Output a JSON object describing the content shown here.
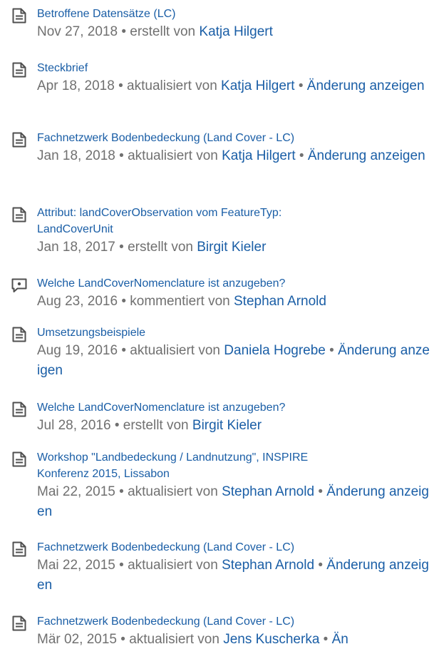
{
  "feed": {
    "items": [
      {
        "icon": "page-icon",
        "title": "Betroffene Datensätze (LC)",
        "date": "Nov 27, 2018",
        "bullet": "•",
        "action": "erstellt von",
        "author": "Katja Hilgert",
        "change_link": ""
      },
      {
        "icon": "page-icon",
        "title": "Steckbrief",
        "date": "Apr 18, 2018",
        "bullet": "•",
        "action": "aktualisiert von",
        "author": "Katja Hilgert",
        "change_link": "Änderung anzeigen"
      },
      {
        "icon": "page-icon",
        "title": "Fachnetzwerk Bodenbedeckung (Land Cover - LC)",
        "date": "Jan 18, 2018",
        "bullet": "•",
        "action": "aktualisiert von",
        "author": "Katja Hilgert",
        "change_link": "Änderung anzeigen"
      },
      {
        "icon": "page-icon",
        "title_line1": "Attribut: landCoverObservation vom FeatureTyp:",
        "title_line2": "LandCoverUnit",
        "date": "Jan 18, 2017",
        "bullet": "•",
        "action": "erstellt von",
        "author": "Birgit Kieler",
        "change_link": ""
      },
      {
        "icon": "comment-icon",
        "title": "Welche LandCoverNomenclature ist anzugeben?",
        "date": "Aug 23, 2016",
        "bullet": "•",
        "action": "kommentiert von",
        "author": "Stephan Arnold",
        "change_link": ""
      },
      {
        "icon": "page-icon",
        "title": "Umsetzungsbeispiele",
        "date": "Aug 19, 2016",
        "bullet": "•",
        "action": "aktualisiert von",
        "author": "Daniela Hogrebe",
        "change_link": "Änderung anzeigen"
      },
      {
        "icon": "page-icon",
        "title": "Welche LandCoverNomenclature ist anzugeben?",
        "date": "Jul 28, 2016",
        "bullet": "•",
        "action": "erstellt von",
        "author": "Birgit Kieler",
        "change_link": ""
      },
      {
        "icon": "page-icon",
        "title_line1": "Workshop \"Landbedeckung / Landnutzung\", INSPIRE",
        "title_line2": "Konferenz 2015, Lissabon",
        "date": "Mai 22, 2015",
        "bullet": "•",
        "action": "aktualisiert von",
        "author": "Stephan Arnold",
        "change_link": "Änderung anzeigen"
      },
      {
        "icon": "page-icon",
        "title": "Fachnetzwerk Bodenbedeckung (Land Cover - LC)",
        "date": "Mai 22, 2015",
        "bullet": "•",
        "action": "aktualisiert von",
        "author": "Stephan Arnold",
        "change_link": "Änderung anzeigen"
      },
      {
        "icon": "page-icon",
        "title": "Fachnetzwerk Bodenbedeckung (Land Cover - LC)",
        "date": "Mär 02, 2015",
        "bullet": "•",
        "action": "aktualisiert von",
        "author": "Jens Kuscherka",
        "change_link": "Än"
      }
    ]
  }
}
